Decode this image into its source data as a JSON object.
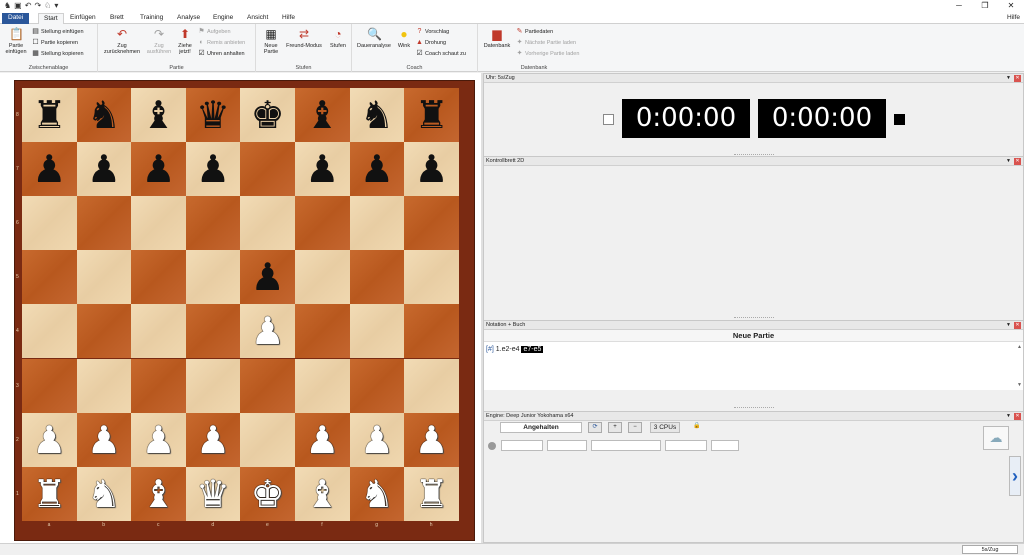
{
  "menu": {
    "file": "Datei",
    "tabs": [
      "Start",
      "Einfügen",
      "Brett",
      "Training",
      "Analyse",
      "Engine",
      "Ansicht",
      "Hilfe"
    ],
    "help": "Hilfe"
  },
  "ribbon": {
    "clipboard": {
      "paste": "Partie\neinfügen",
      "paste_pos": "Stellung einfügen",
      "copy_game": "Partie kopieren",
      "copy_pos": "Stellung kopieren",
      "label": "Zwischenablage"
    },
    "game": {
      "takeback": "Zug\nzurücknehmen",
      "replay": "Zug\nausführen",
      "move_now": "Ziehe\njetzt!",
      "resign": "Aufgeben",
      "offer_draw": "Remis anbieten",
      "stop_clocks": "Uhren anhalten",
      "label": "Partie"
    },
    "levels": {
      "new_game": "Neue\nPartie",
      "friend": "Freund-Modus",
      "levels": "Stufen",
      "label": "Stufen"
    },
    "coach": {
      "analysis": "Daueranalyse",
      "hint": "Wink",
      "suggest": "Vorschlag",
      "threat": "Drohung",
      "coach_watch": "Coach schaut zu",
      "label": "Coach"
    },
    "db": {
      "database": "Datenbank",
      "gamedata": "Partiedaten",
      "next": "Nächste Partie laden",
      "prev": "Vorherige Partie laden",
      "label": "Datenbank"
    }
  },
  "clock": {
    "title": "Uhr: 5s/Zug",
    "white": "0:00:00",
    "black": "0:00:00"
  },
  "board2d": {
    "title": "Kontrollbrett 2D"
  },
  "notation": {
    "title": "Notation + Buch",
    "heading": "Neue Partie",
    "marker": "[#]",
    "move1": "1.e2-e4",
    "move2": "e7-e5"
  },
  "engine": {
    "title": "Engine: Deep Junior Yokohama x64",
    "status": "Angehalten",
    "cpus": "3 CPUs"
  },
  "files": [
    "a",
    "b",
    "c",
    "d",
    "e",
    "f",
    "g",
    "h"
  ],
  "ranks": [
    "8",
    "7",
    "6",
    "5",
    "4",
    "3",
    "2",
    "1"
  ],
  "status": {
    "mode": "5s/Zug"
  }
}
